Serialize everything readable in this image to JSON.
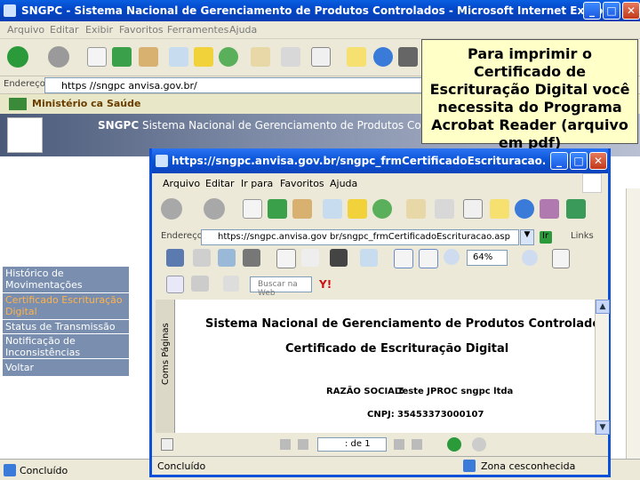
{
  "window": {
    "title": "SNGPC - Sistema Nacional de Gerenciamento de Produtos Controlados - Microsoft Internet Explorer"
  },
  "menu": [
    "Arquivo",
    "Editar",
    "Exibir",
    "Favoritos",
    "Ferramentes",
    "Ajuda"
  ],
  "address": {
    "label": "Endereço",
    "url": "https //sngpc anvisa.gov.br/"
  },
  "site": {
    "ministry": "Ministério ca Saúde",
    "brand": "SNGPC",
    "brand_sub": "Sistema Nacional de Gerenciamento de Produtos Controlados"
  },
  "nav": [
    "Histórico de Movimentações",
    "Certificado Escrituração Digital",
    "Status de Transmissão",
    "Notificação de Inconsistências",
    "Voltar"
  ],
  "callout": "Para imprimir o Certificado de Escrituração Digital você necessita do Programa Acrobat Reader (arquivo em pdf)",
  "status": {
    "text": "Concluído"
  },
  "popup": {
    "title": "https://sngpc.anvisa.gov.br/sngpc_frmCertificadoEscrituracao.asp - Micr...",
    "menu": [
      "Arquivo",
      "Editar",
      "Ir para",
      "Favoritos",
      "Ajuda"
    ],
    "address_label": "Endereço",
    "address_url": "https://sngpc.anvisa.gov br/sngpc_frmCertificadoEscrituracao.asp",
    "go": "Ir",
    "links": "Links",
    "zoom": "64%",
    "search_label": "Buscar na Web",
    "side_tabs": "Coms Páginas",
    "doc_title": "Sistema Nacional de Gerenciamento de Produtos Controlados",
    "doc_subtitle": "Certificado de Escrituração Digital",
    "razao_label": "RAZÃO SOCIAL:",
    "razao_value": "Teste JPROC sngpc ltda",
    "cnpj_label": "CNPJ:",
    "cnpj_value": "35453373000107",
    "page_indicator": ": de 1",
    "status_left": "Concluído",
    "status_right": "Zona cesconhecida"
  },
  "colors": {
    "xp_blue": "#0a52d6",
    "nav_bg": "#7a8fb0",
    "nav_active": "#ffb24a",
    "callout_bg": "#ffffc8"
  }
}
